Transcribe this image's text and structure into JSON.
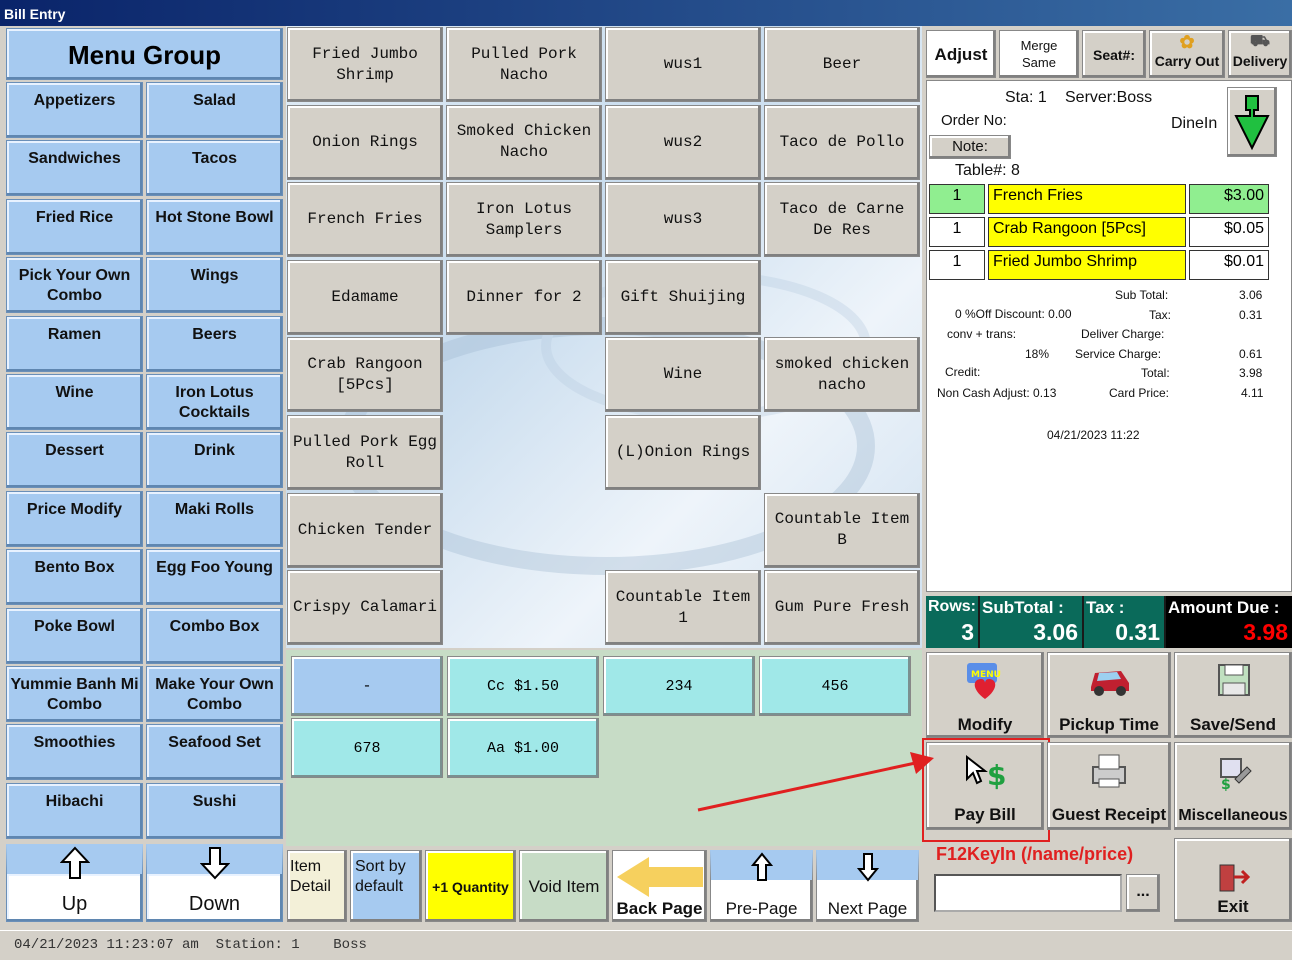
{
  "window": {
    "title": "Bill Entry"
  },
  "menu_group": {
    "title": "Menu Group",
    "items": [
      "Appetizers",
      "Salad",
      "Sandwiches",
      "Tacos",
      "Fried Rice",
      "Hot Stone Bowl",
      "Pick Your Own Combo",
      "Wings",
      "Ramen",
      "Beers",
      "Wine",
      "Iron Lotus Cocktails",
      "Dessert",
      "Drink",
      "Price Modify",
      "Maki Rolls",
      "Bento Box",
      "Egg Foo Young",
      "Poke Bowl",
      "Combo Box",
      "Yummie Banh Mi Combo",
      "Make Your Own Combo",
      "Smoothies",
      "Seafood Set",
      "Hibachi",
      "Sushi"
    ],
    "up_label": "Up",
    "down_label": "Down"
  },
  "menu_items": [
    "Fried Jumbo Shrimp",
    "Pulled Pork Nacho",
    "wus1",
    "Beer",
    "Onion Rings",
    "Smoked Chicken Nacho",
    "wus2",
    "Taco de Pollo",
    "French Fries",
    "Iron Lotus Samplers",
    "wus3",
    "Taco de Carne De Res",
    "Edamame",
    "Dinner for 2",
    "Gift Shuijing",
    "Crab Rangoon [5Pcs]",
    "Wine",
    "smoked chicken nacho",
    "Pulled Pork Egg Roll",
    "(L)Onion Rings",
    "Chicken Tender",
    "Countable Item B",
    "Crispy Calamari",
    "Countable Item 1",
    "Gum Pure Fresh"
  ],
  "modifiers": [
    "-",
    "Cc $1.50",
    "234",
    "456",
    "678",
    "Aa $1.00"
  ],
  "bottom_toolbar": {
    "item_detail": "Item Detail",
    "sort_by_default": "Sort by default",
    "plus_one_quantity": "+1 Quantity",
    "void_item": "Void Item",
    "back_page": "Back Page",
    "pre_page": "Pre-Page",
    "next_page": "Next Page"
  },
  "top_right": {
    "adjust": "Adjust",
    "merge_same": "Merge Same",
    "seat": "Seat#:",
    "carry_out": "Carry Out",
    "delivery": "Delivery"
  },
  "ticket": {
    "station": "Sta: 1",
    "server": "Server:Boss",
    "order_no_label": "Order No:",
    "order_type": "DineIn",
    "note_label": "Note:",
    "table": "Table#: 8",
    "lines": [
      {
        "qty": "1",
        "name": "French Fries",
        "price": "$3.00"
      },
      {
        "qty": "1",
        "name": "Crab Rangoon [5Pcs]",
        "price": "$0.05"
      },
      {
        "qty": "1",
        "name": "Fried Jumbo Shrimp",
        "price": "$0.01"
      }
    ],
    "sub_total_label": "Sub Total:",
    "sub_total": "3.06",
    "discount": "0 %Off Discount: 0.00",
    "tax_label": "Tax:",
    "tax": "0.31",
    "conv_trans": "conv + trans:",
    "deliver_charge_label": "Deliver Charge:",
    "service_pct": "18%",
    "service_charge_label": "Service Charge:",
    "service_charge": "0.61",
    "credit_label": "Credit:",
    "total_label": "Total:",
    "total": "3.98",
    "non_cash_adjust": "Non Cash Adjust: 0.13",
    "card_price_label": "Card Price:",
    "card_price": "4.11",
    "datetime": "04/21/2023 11:22"
  },
  "totals": {
    "rows_label": "Rows:",
    "rows": "3",
    "subtotal_label": "SubTotal :",
    "subtotal": "3.06",
    "tax_label": "Tax :",
    "tax": "0.31",
    "amount_due_label": "Amount Due :",
    "amount_due": "3.98"
  },
  "actions": {
    "modify": "Modify",
    "pickup_time": "Pickup Time",
    "save_send": "Save/Send",
    "pay_bill": "Pay Bill",
    "guest_receipt": "Guest Receipt",
    "miscellaneous": "Miscellaneous",
    "f12_label": "F12KeyIn (/name/price)",
    "f12_input": "",
    "browse": "...",
    "exit": "Exit"
  },
  "status_bar": {
    "datetime": "04/21/2023 11:23:07 am",
    "station": "Station: 1",
    "user": "Boss"
  },
  "colors": {
    "menu_blue": "#a6caf0",
    "highlight_yellow": "#ffff00",
    "qty_green": "#90ee90",
    "modifier_cyan": "#a0e8e8",
    "amount_due_red": "#ff0000",
    "annotation_red": "#e02020"
  }
}
